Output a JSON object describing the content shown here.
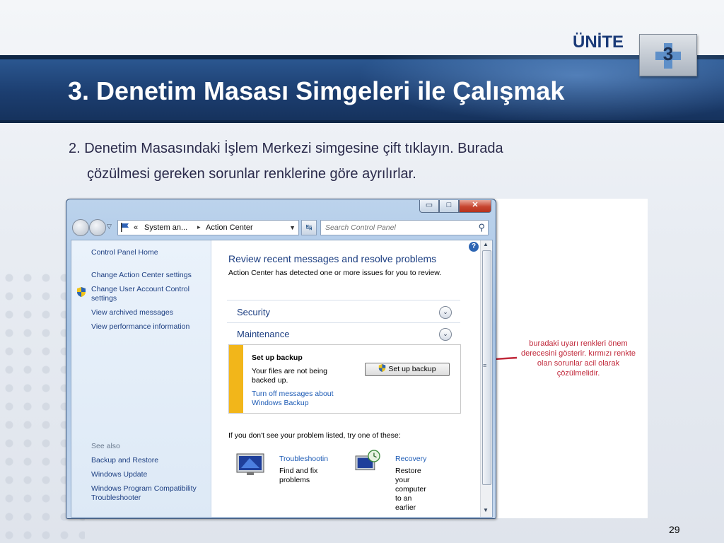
{
  "slide": {
    "unit_label": "ÜNİTE",
    "unit_number": "3",
    "title": "3. Denetim Masası Simgeleri ile Çalışmak",
    "bullet_line1": "2. Denetim Masasındaki İşlem Merkezi simgesine çift tıklayın. Burada",
    "bullet_line2": "çözülmesi gereken sorunlar renklerine göre ayrılırlar.",
    "page_number": "29",
    "note": "buradaki uyarı renkleri önem derecesini gösterir. kırmızı renkte olan sorunlar acil olarak çözülmelidir.",
    "note_color": "#c0283a",
    "title_band_color": "#1c3e70"
  },
  "window": {
    "caption": {
      "minimize": "▭",
      "maximize": "□",
      "close": "✕"
    },
    "nav": {
      "back_icon": "back-arrow-icon",
      "forward_icon": "forward-arrow-icon",
      "breadcrumb_prefix": "«",
      "breadcrumb_1": "System an...",
      "breadcrumb_separator": "▸",
      "breadcrumb_2": "Action Center",
      "search_placeholder": "Search Control Panel"
    },
    "left_pane": {
      "home": "Control Panel Home",
      "change_settings": "Change Action Center settings",
      "change_uac": "Change User Account Control settings",
      "view_archived": "View archived messages",
      "view_perf": "View performance information",
      "see_also": "See also",
      "backup_restore": "Backup and Restore",
      "windows_update": "Windows Update",
      "compat_troubleshooter": "Windows Program Compatibility Troubleshooter"
    },
    "main": {
      "heading": "Review recent messages and resolve problems",
      "description": "Action Center has detected one or more issues for you to review.",
      "security": "Security",
      "maintenance": "Maintenance",
      "message": {
        "title": "Set up backup",
        "description": "Your files are not being backed up.",
        "link": "Turn off messages about Windows Backup",
        "button": "Set up backup",
        "severity_color": "#f2b61a"
      },
      "see_if": "If you don't see your problem listed, try one of these:",
      "troubleshoot_title": "Troubleshootin",
      "troubleshoot_desc": "Find and fix problems",
      "recovery_title": "Recovery",
      "recovery_desc": "Restore your computer to an earlier"
    }
  }
}
